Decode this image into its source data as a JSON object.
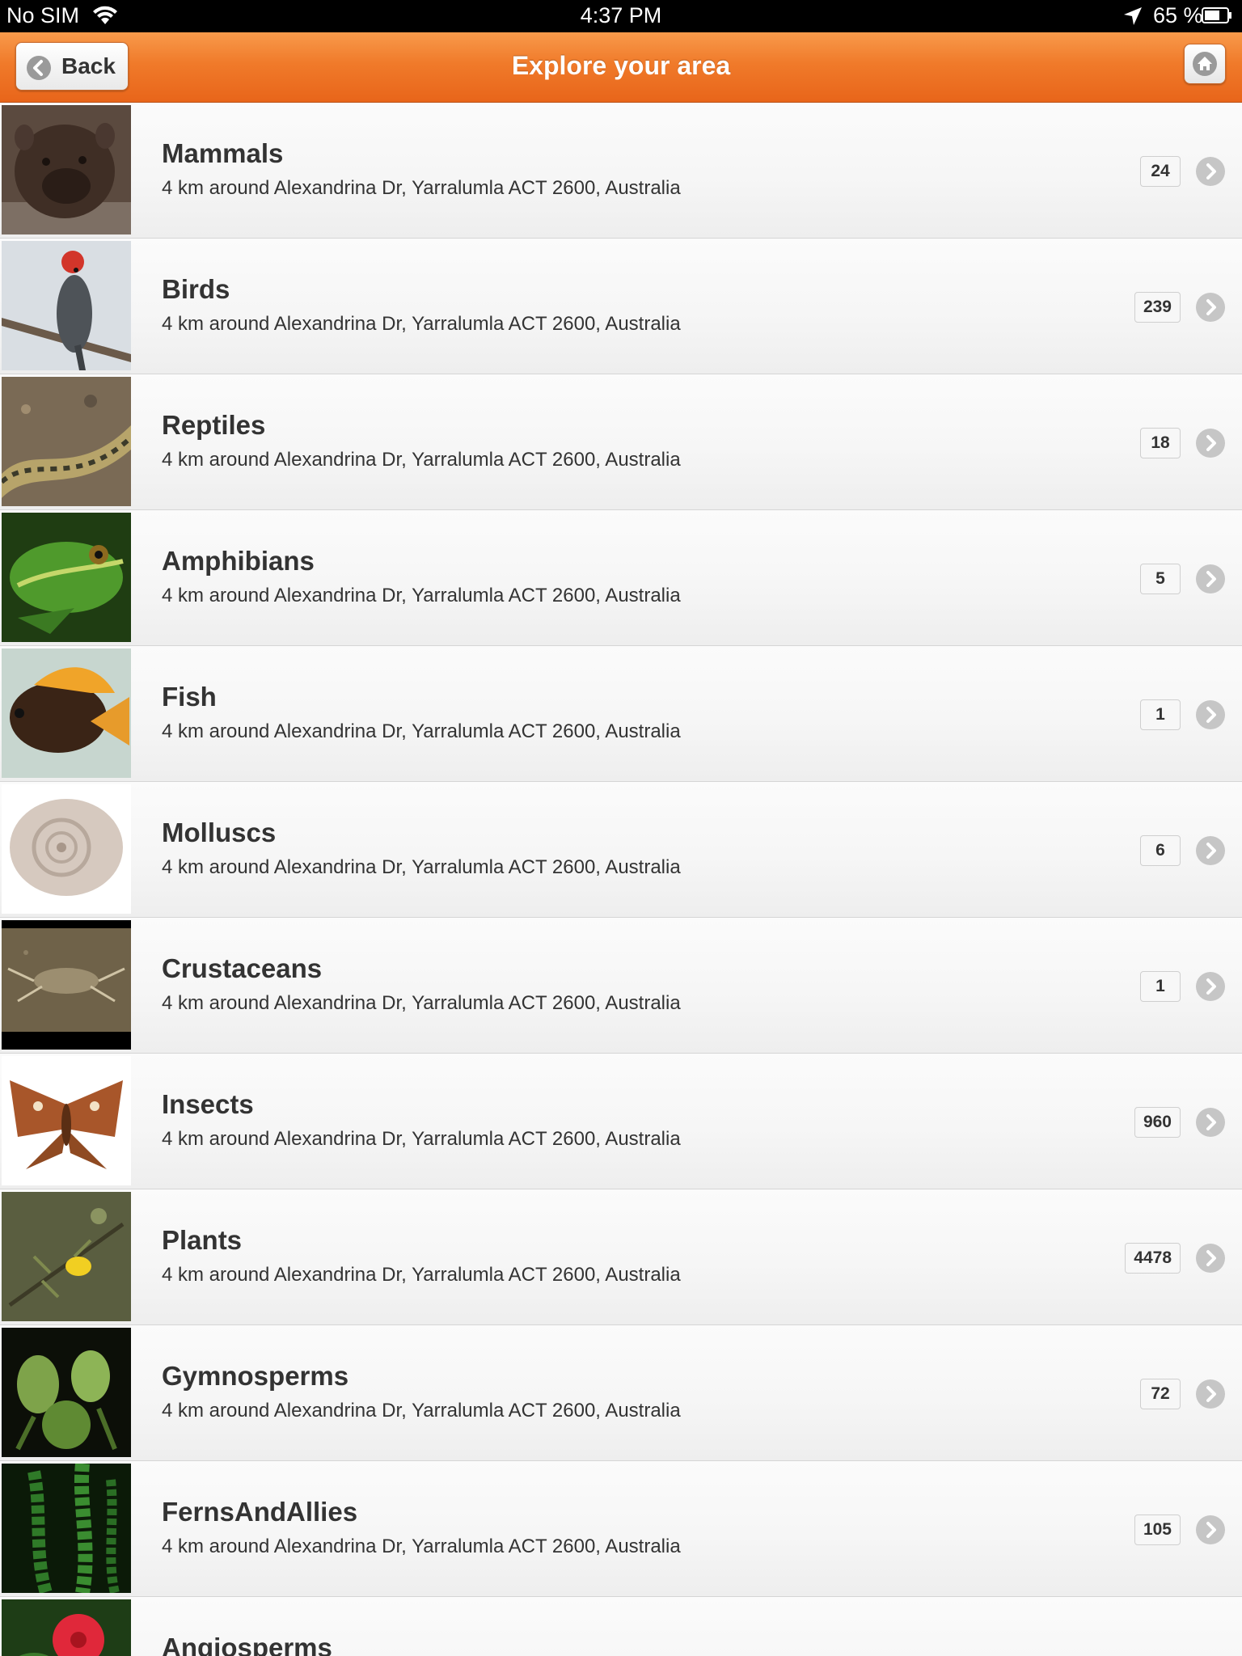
{
  "status_bar": {
    "carrier": "No SIM",
    "time": "4:37 PM",
    "battery": "65 %"
  },
  "nav": {
    "title": "Explore your area",
    "back_label": "Back"
  },
  "colors": {
    "accent": "#f07a2a",
    "nav_gradient_top": "#f89a4b",
    "nav_gradient_bottom": "#e8651a",
    "text": "#333333"
  },
  "icons": {
    "back": "chevron-left-circle-icon",
    "home": "home-icon",
    "row_disclosure": "chevron-right-circle-icon"
  },
  "rows": [
    {
      "title": "Mammals",
      "subtitle": "4 km around Alexandrina Dr, Yarralumla ACT 2600, Australia",
      "count": "24"
    },
    {
      "title": "Birds",
      "subtitle": "4 km around Alexandrina Dr, Yarralumla ACT 2600, Australia",
      "count": "239"
    },
    {
      "title": "Reptiles",
      "subtitle": "4 km around Alexandrina Dr, Yarralumla ACT 2600, Australia",
      "count": "18"
    },
    {
      "title": "Amphibians",
      "subtitle": "4 km around Alexandrina Dr, Yarralumla ACT 2600, Australia",
      "count": "5"
    },
    {
      "title": "Fish",
      "subtitle": "4 km around Alexandrina Dr, Yarralumla ACT 2600, Australia",
      "count": "1"
    },
    {
      "title": "Molluscs",
      "subtitle": "4 km around Alexandrina Dr, Yarralumla ACT 2600, Australia",
      "count": "6"
    },
    {
      "title": "Crustaceans",
      "subtitle": "4 km around Alexandrina Dr, Yarralumla ACT 2600, Australia",
      "count": "1"
    },
    {
      "title": "Insects",
      "subtitle": "4 km around Alexandrina Dr, Yarralumla ACT 2600, Australia",
      "count": "960"
    },
    {
      "title": "Plants",
      "subtitle": "4 km around Alexandrina Dr, Yarralumla ACT 2600, Australia",
      "count": "4478"
    },
    {
      "title": "Gymnosperms",
      "subtitle": "4 km around Alexandrina Dr, Yarralumla ACT 2600, Australia",
      "count": "72"
    },
    {
      "title": "FernsAndAllies",
      "subtitle": "4 km around Alexandrina Dr, Yarralumla ACT 2600, Australia",
      "count": "105"
    },
    {
      "title": "Angiosperms",
      "subtitle": "",
      "count": ""
    }
  ]
}
